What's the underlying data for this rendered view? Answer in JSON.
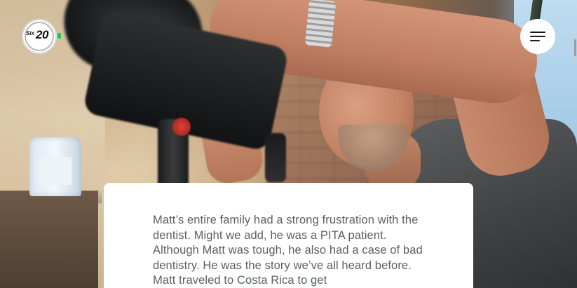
{
  "header": {
    "logo": {
      "prefix": "Six",
      "number": "20",
      "accent_color": "#23c552"
    },
    "menu_button": {
      "icon": "hamburger-menu-icon"
    }
  },
  "story": {
    "paragraph": "Matt’s entire family had a strong frustration with the dentist. Might we add, he was a PITA patient. Although Matt was tough, he also had a case of bad dentistry. He was the story we’ve all heard before. Matt traveled to Costa Rica to get"
  },
  "colors": {
    "card_background": "#ffffff",
    "body_text": "#5b5f63"
  }
}
